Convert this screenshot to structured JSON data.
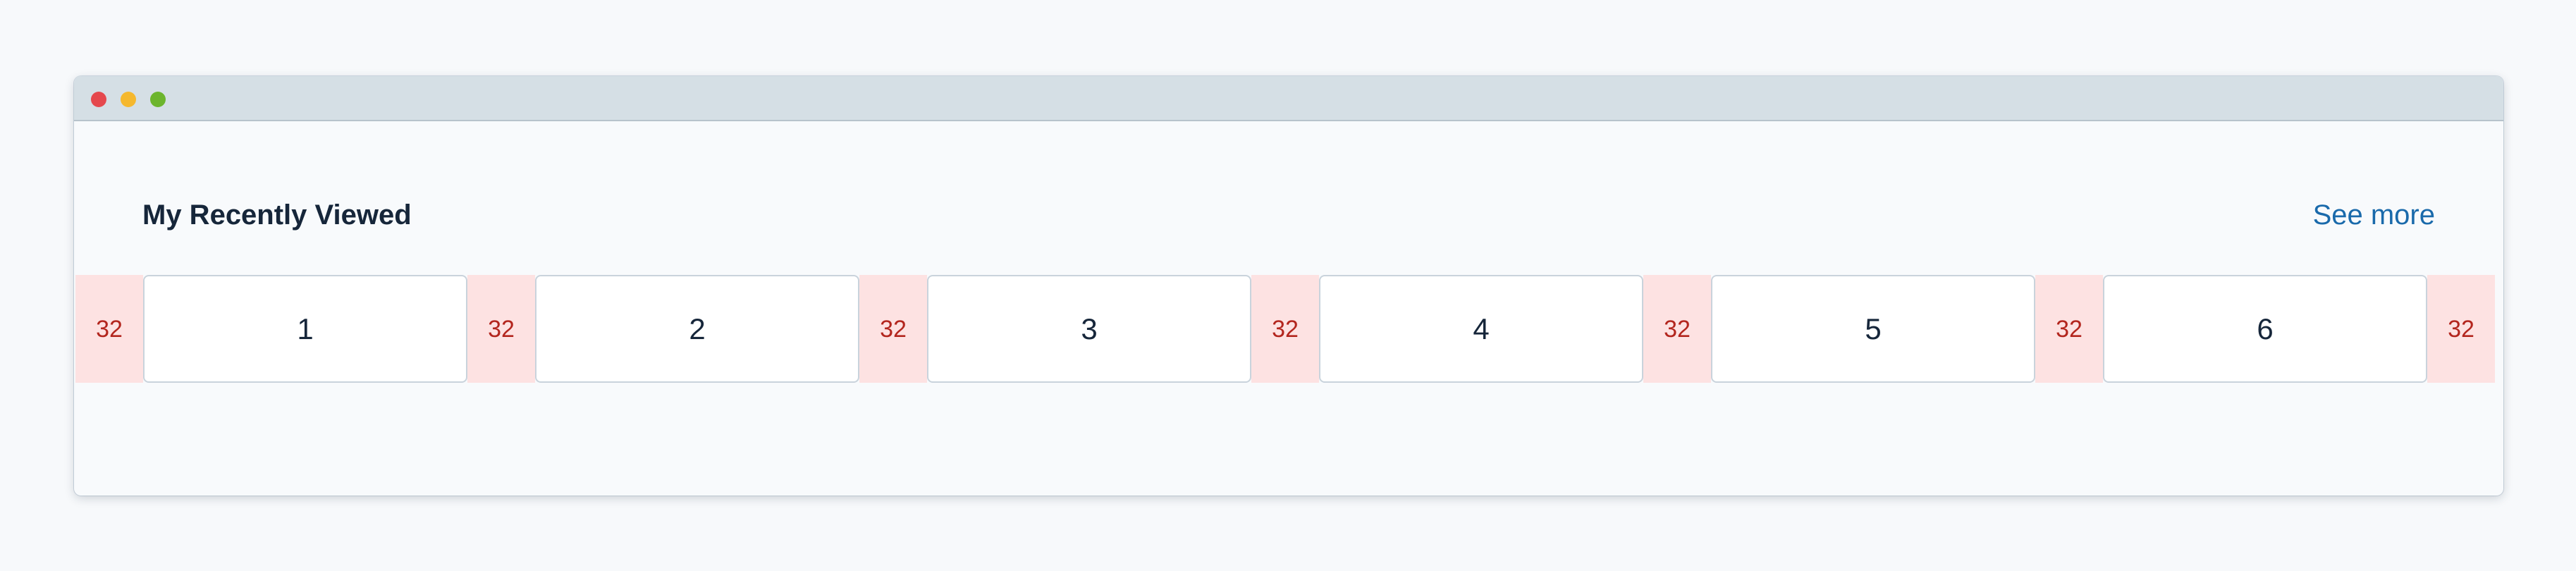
{
  "colors": {
    "close_dot": "#e5484d",
    "minimize_dot": "#f5b82e",
    "maximize_dot": "#6cb52d",
    "spacing_fill": "#fde2e2",
    "spacing_text": "#b3261e",
    "link": "#1a6aab",
    "heading": "#16263a"
  },
  "section": {
    "title": "My Recently Viewed",
    "see_more_label": "See more"
  },
  "spacing_label": "32",
  "cards": [
    "1",
    "2",
    "3",
    "4",
    "5",
    "6"
  ]
}
